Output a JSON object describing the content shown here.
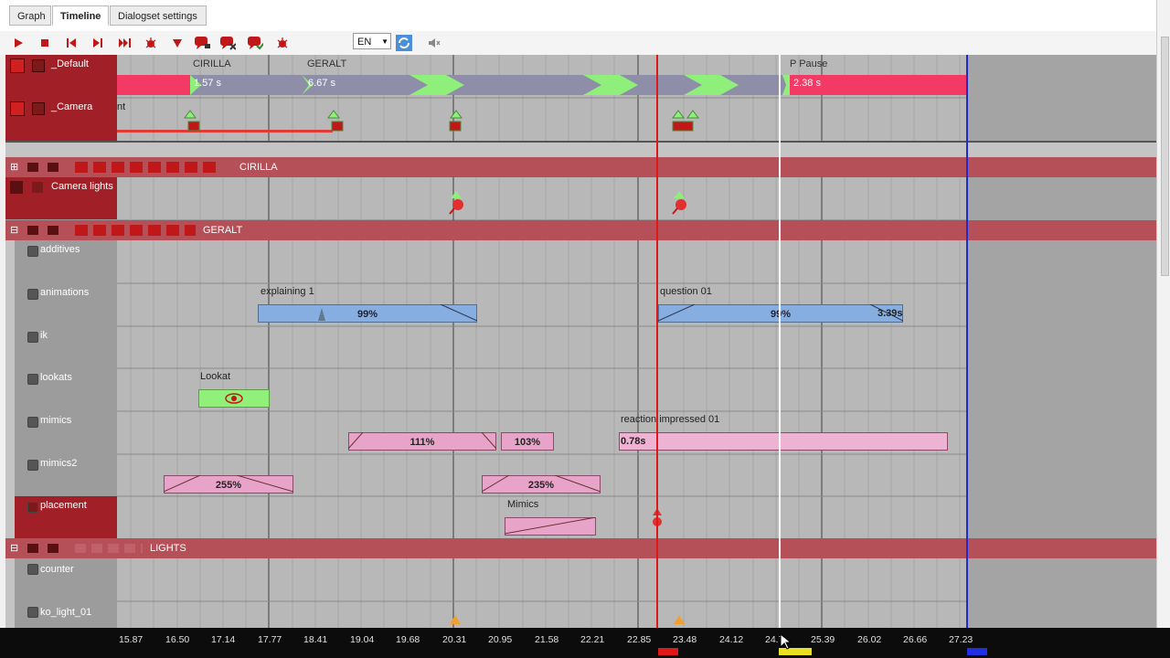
{
  "tabs": [
    {
      "label": "Graph"
    },
    {
      "label": "Timeline"
    },
    {
      "label": "Dialogset settings"
    }
  ],
  "toolbar": {
    "language": "EN"
  },
  "tracks": {
    "default": {
      "label": "_Default",
      "events": [
        "CIRILLA",
        "GERALT",
        "P Pause"
      ],
      "durations": [
        "1.57 s",
        "6.67 s",
        "2.38 s"
      ]
    },
    "camera": {
      "label": "_Camera",
      "stub": "nt"
    },
    "cirilla_group": {
      "label": "CIRILLA"
    },
    "camera_lights": {
      "label": "Camera lights"
    },
    "geralt_group": {
      "label": "GERALT"
    },
    "additives": {
      "label": "additives"
    },
    "animations": {
      "label": "animations",
      "clips": [
        {
          "name": "explaining 1",
          "pct": "99%"
        },
        {
          "name": "question 01",
          "pct": "99%",
          "dur": "3.39s"
        }
      ]
    },
    "ik": {
      "label": "ik"
    },
    "lookats": {
      "label": "lookats",
      "clip": "Lookat"
    },
    "mimics": {
      "label": "mimics",
      "clips": [
        "111%",
        "103%"
      ],
      "reaction": "reaction impressed 01",
      "reaction_dur": "0.78s"
    },
    "mimics2": {
      "label": "mimics2",
      "clips": [
        "255%",
        "235%"
      ],
      "extra": "Mimics"
    },
    "placement": {
      "label": "placement"
    },
    "lights_group": {
      "label": "LIGHTS"
    },
    "counter": {
      "label": "counter"
    },
    "ko_light": {
      "label": "ko_light_01"
    }
  },
  "ruler": {
    "ticks": [
      "15.87",
      "16.50",
      "17.14",
      "17.77",
      "18.41",
      "19.04",
      "19.68",
      "20.31",
      "20.95",
      "21.58",
      "22.21",
      "22.85",
      "23.48",
      "24.12",
      "24.7",
      "25.39",
      "26.02",
      "26.66",
      "27.23"
    ]
  }
}
